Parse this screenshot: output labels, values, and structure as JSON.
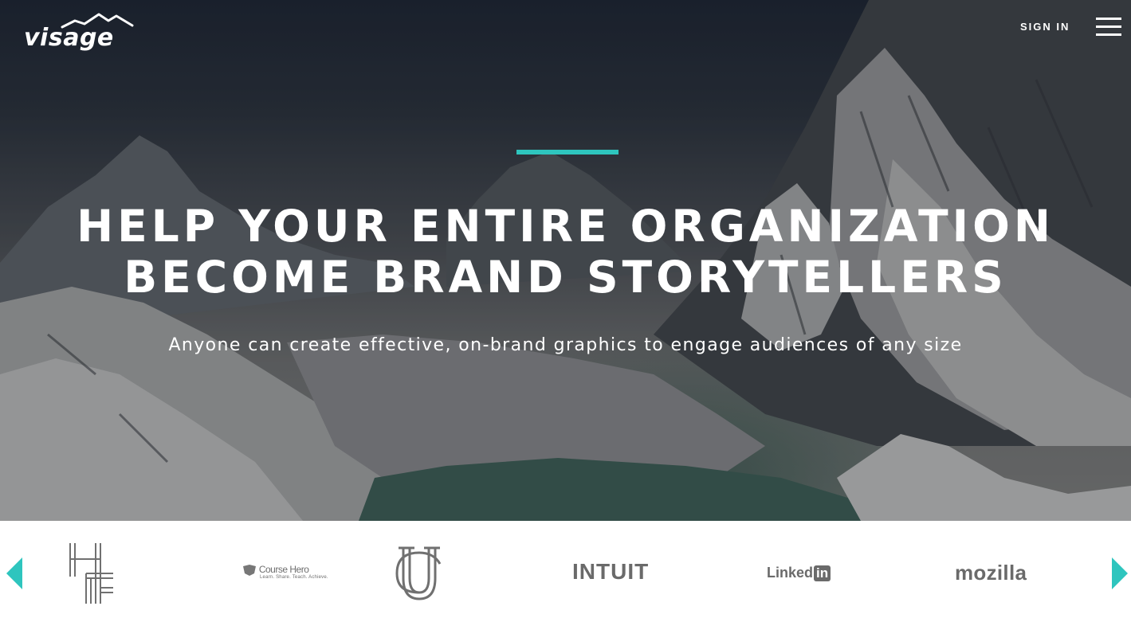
{
  "header": {
    "logo_text": "visage",
    "signin_label": "SIGN IN"
  },
  "hero": {
    "headline_line1": "HELP YOUR ENTIRE ORGANIZATION",
    "headline_line2": "BECOME BRAND STORYTELLERS",
    "subhead": "Anyone can create effective, on-brand graphics to engage audiences of any size"
  },
  "colors": {
    "accent": "#2ec5be",
    "logo_gray": "#6a6a6a"
  },
  "carousel": {
    "brands": {
      "course_hero": "Course Hero",
      "course_hero_tagline": "Learn. Share. Teach. Achieve.",
      "intuit": "INTUIT",
      "linkedin": "Linked",
      "linkedin_badge": "in",
      "mozilla": "mozilla"
    },
    "icons": {
      "prev": "chevron-left-icon",
      "next": "chevron-right-icon"
    }
  }
}
